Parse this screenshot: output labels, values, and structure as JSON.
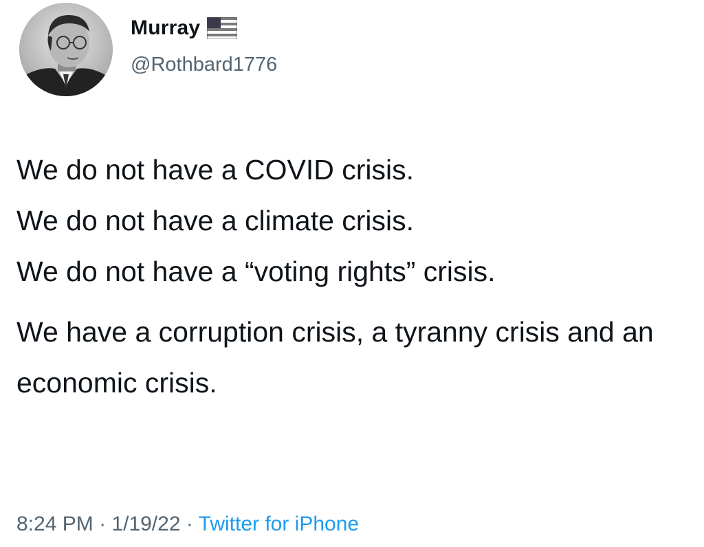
{
  "tweet": {
    "display_name": "Murray",
    "handle": "@Rothbard1776",
    "avatar_icon": "profile-photo",
    "flag_icon": "us-flag-icon",
    "body_paragraphs": [
      "We do not have a COVID crisis.\nWe do not have a climate crisis.\nWe do not have a “voting rights” crisis.",
      "We have a corruption crisis, a tyranny crisis and an economic crisis."
    ],
    "time": "8:24 PM",
    "date": "1/19/22",
    "separator": "·",
    "source": "Twitter for iPhone",
    "colors": {
      "text": "#0f1419",
      "secondary": "#536471",
      "link": "#1d9bf0"
    }
  }
}
